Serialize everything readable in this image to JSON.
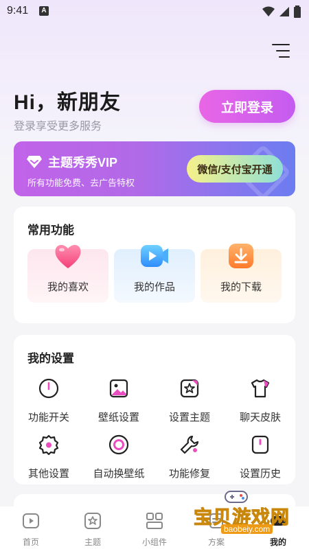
{
  "status_bar": {
    "time": "9:41",
    "app_badge": "A"
  },
  "header": {
    "greeting": "Hi，新朋友",
    "sub_greeting": "登录享受更多服务",
    "login_button": "立即登录"
  },
  "vip": {
    "title": "主题秀秀VIP",
    "description": "所有功能免费、去广告特权",
    "button": "微信/支付宝开通"
  },
  "common_functions": {
    "title": "常用功能",
    "items": [
      {
        "label": "我的喜欢",
        "icon": "heart-icon"
      },
      {
        "label": "我的作品",
        "icon": "video-icon"
      },
      {
        "label": "我的下载",
        "icon": "download-icon"
      }
    ]
  },
  "settings": {
    "title": "我的设置",
    "items": [
      {
        "label": "功能开关",
        "icon": "power-icon"
      },
      {
        "label": "壁纸设置",
        "icon": "image-icon"
      },
      {
        "label": "设置主题",
        "icon": "theme-icon"
      },
      {
        "label": "聊天皮肤",
        "icon": "tshirt-icon"
      },
      {
        "label": "其他设置",
        "icon": "gear-icon"
      },
      {
        "label": "自动换壁纸",
        "icon": "refresh-circle-icon"
      },
      {
        "label": "功能修复",
        "icon": "wrench-icon"
      },
      {
        "label": "设置历史",
        "icon": "history-icon"
      }
    ]
  },
  "bottom_nav": {
    "items": [
      {
        "label": "首页",
        "icon": "play-square-icon"
      },
      {
        "label": "主题",
        "icon": "theme-icon"
      },
      {
        "label": "小组件",
        "icon": "widgets-icon"
      },
      {
        "label": "方案",
        "icon": "plan-icon"
      },
      {
        "label": "我的",
        "icon": "profile-icon"
      }
    ],
    "active": "我的"
  },
  "watermark": {
    "text": "宝贝游戏网",
    "url": "baobeiy.com"
  },
  "colors": {
    "accent": "#c45cf0",
    "vip_start": "#c163e9",
    "vip_end": "#6c7cf0"
  }
}
